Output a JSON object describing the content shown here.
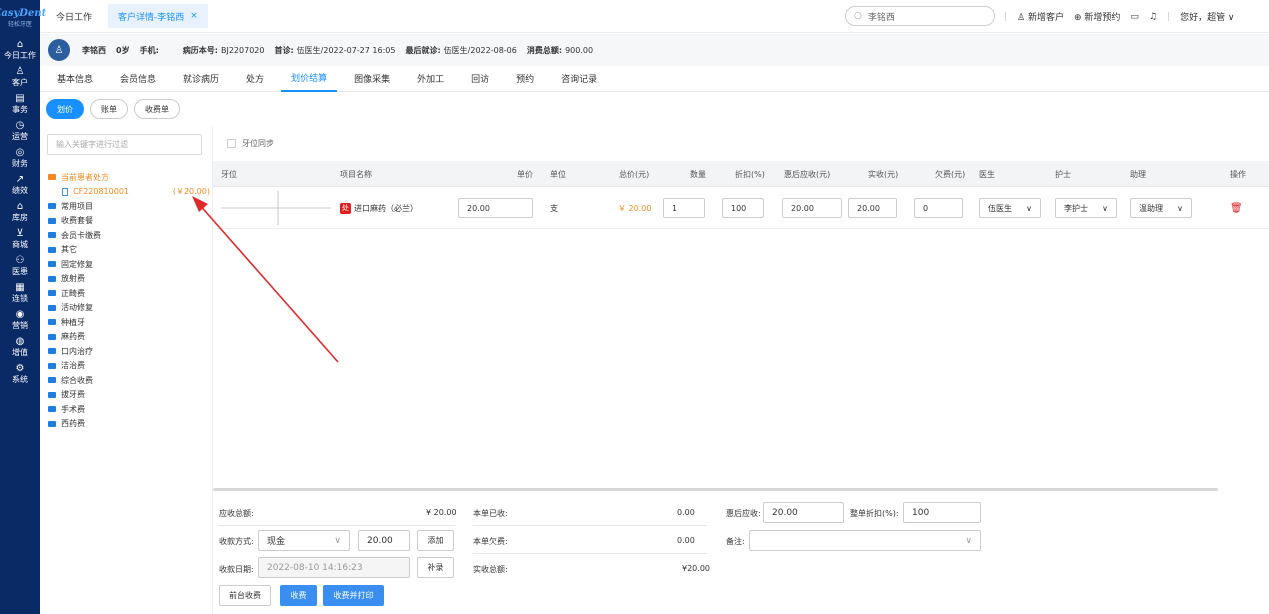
{
  "logo": {
    "brand": "EasyDent",
    "sub": "轻松牙医"
  },
  "sidebar": {
    "items": [
      {
        "icon": "home-icon",
        "glyph": "⌂",
        "label": "今日工作"
      },
      {
        "icon": "user-icon",
        "glyph": "♙",
        "label": "客户"
      },
      {
        "icon": "task-icon",
        "glyph": "▤",
        "label": "事务"
      },
      {
        "icon": "clock-icon",
        "glyph": "◷",
        "label": "运营"
      },
      {
        "icon": "finance-icon",
        "glyph": "◎",
        "label": "财务"
      },
      {
        "icon": "chart-icon",
        "glyph": "↗",
        "label": "绩效"
      },
      {
        "icon": "warehouse-icon",
        "glyph": "⌂",
        "label": "库房"
      },
      {
        "icon": "cart-icon",
        "glyph": "⊻",
        "label": "商城"
      },
      {
        "icon": "insurance-icon",
        "glyph": "⚇",
        "label": "医患"
      },
      {
        "icon": "chain-icon",
        "glyph": "▦",
        "label": "连锁"
      },
      {
        "icon": "marketing-icon",
        "glyph": "◉",
        "label": "营销"
      },
      {
        "icon": "value-icon",
        "glyph": "◍",
        "label": "增值"
      },
      {
        "icon": "settings-icon",
        "glyph": "⚙",
        "label": "系统"
      }
    ]
  },
  "topbar": {
    "tab_today": "今日工作",
    "tab_active": "客户详情-李铭西",
    "tab_close": "×",
    "search_value": "李铭西",
    "new_customer": "新增客户",
    "new_appointment": "新增预约",
    "greeting": "您好，超管 ∨"
  },
  "patient": {
    "name": "李铭西",
    "age": "0岁",
    "phone_label": "手机:",
    "record_label": "病历本号:",
    "record_value": "BJ2207020",
    "first_label": "首诊:",
    "first_value": "伍医生/2022-07-27 16:05",
    "last_label": "最后就诊:",
    "last_value": "伍医生/2022-08-06",
    "total_label": "消费总额:",
    "total_value": "900.00"
  },
  "subtabs": [
    "基本信息",
    "会员信息",
    "就诊病历",
    "处方",
    "划价结算",
    "图像采集",
    "外加工",
    "回访",
    "预约",
    "咨询记录"
  ],
  "pills": [
    "划价",
    "账单",
    "收费单"
  ],
  "left": {
    "filter_placeholder": "输入关键字进行过滤",
    "tree": [
      {
        "label": "当前患者处方",
        "active": true
      },
      {
        "label": "CF220810001",
        "amount": "(￥20.00)",
        "leaf": true
      },
      {
        "label": "常用项目"
      },
      {
        "label": "收费套餐"
      },
      {
        "label": "会员卡缴费"
      },
      {
        "label": "其它"
      },
      {
        "label": "固定修复"
      },
      {
        "label": "放射费"
      },
      {
        "label": "正畸费"
      },
      {
        "label": "活动修复"
      },
      {
        "label": "种植牙"
      },
      {
        "label": "麻药费"
      },
      {
        "label": "口内治疗"
      },
      {
        "label": "洁治费"
      },
      {
        "label": "综合收费"
      },
      {
        "label": "拔牙费"
      },
      {
        "label": "手术费"
      },
      {
        "label": "西药费"
      }
    ]
  },
  "table": {
    "sync_label": "牙位同步",
    "headers": [
      "牙位",
      "项目名称",
      "单价",
      "单位",
      "总价(元)",
      "数量",
      "折扣(%)",
      "惠后应收(元)",
      "实收(元)",
      "欠费(元)",
      "医生",
      "护士",
      "助理",
      "操作"
    ],
    "row": {
      "badge": "处",
      "name": "进口麻药（必兰）",
      "price": "20.00",
      "unit": "支",
      "total": "￥ 20.00",
      "qty": "1",
      "discount": "100",
      "after": "20.00",
      "paid": "20.00",
      "owed": "0",
      "doctor": "伍医生",
      "nurse": "李护士",
      "assistant": "温助理"
    }
  },
  "bottom": {
    "due_label": "应收总额:",
    "due_value": "¥ 20.00",
    "received_label": "本单已收:",
    "received_value": "0.00",
    "after_label": "惠后应收:",
    "after_value": "20.00",
    "disc_label": "整单折扣(%):",
    "disc_value": "100",
    "method_label": "收款方式:",
    "method_value": "现金",
    "method_amount": "20.00",
    "add_btn": "添加",
    "owe_label": "本单欠费:",
    "owe_value": "0.00",
    "note_label": "备注:",
    "date_label": "收款日期:",
    "date_value": "2022-08-10 14:16:23",
    "supp_btn": "补录",
    "actual_label": "实收总额:",
    "actual_value": "¥20.00",
    "btn_front": "前台收费",
    "btn_charge": "收费",
    "btn_charge_print": "收费并打印"
  },
  "colors": {
    "primary": "#1890ff",
    "sidebar": "#0a2a66",
    "accent_orange": "#f5891d",
    "arrow": "#e02a2a"
  }
}
